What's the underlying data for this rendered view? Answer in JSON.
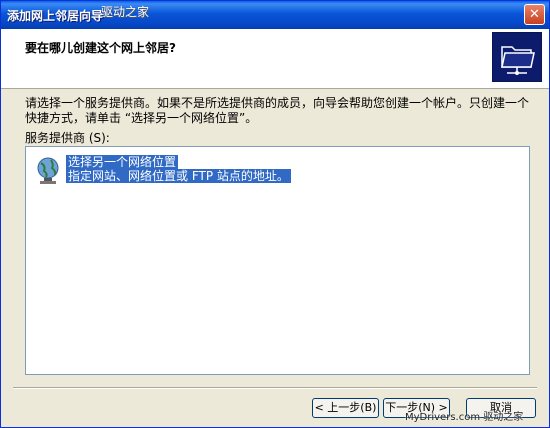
{
  "window": {
    "title": "添加网上邻居向导",
    "close_glyph": "✕",
    "watermark_top": "驱动之家"
  },
  "header": {
    "title": "要在哪儿创建这个网上邻居?",
    "icon": "network-folder-icon"
  },
  "body": {
    "description": "请选择一个服务提供商。如果不是所选提供商的成员，向导会帮助您创建一个帐户。只创建一个快捷方式，请单击 “选择另一个网络位置”。",
    "list_label": "服务提供商 (S):",
    "items": [
      {
        "icon": "network-globe-icon",
        "title": "选择另一个网络位置",
        "subtitle": "指定网站、网络位置或 FTP 站点的地址。",
        "selected": true
      }
    ]
  },
  "buttons": {
    "back": "< 上一步(B)",
    "next": "下一步(N) >",
    "cancel": "取消"
  },
  "watermark_bottom": "MyDrivers.com 驱动之家",
  "colors": {
    "titlebar": "#0a55d8",
    "selection": "#316ac5",
    "dialog_bg": "#ece9d8",
    "header_icon_bg": "#0c1b6b"
  }
}
